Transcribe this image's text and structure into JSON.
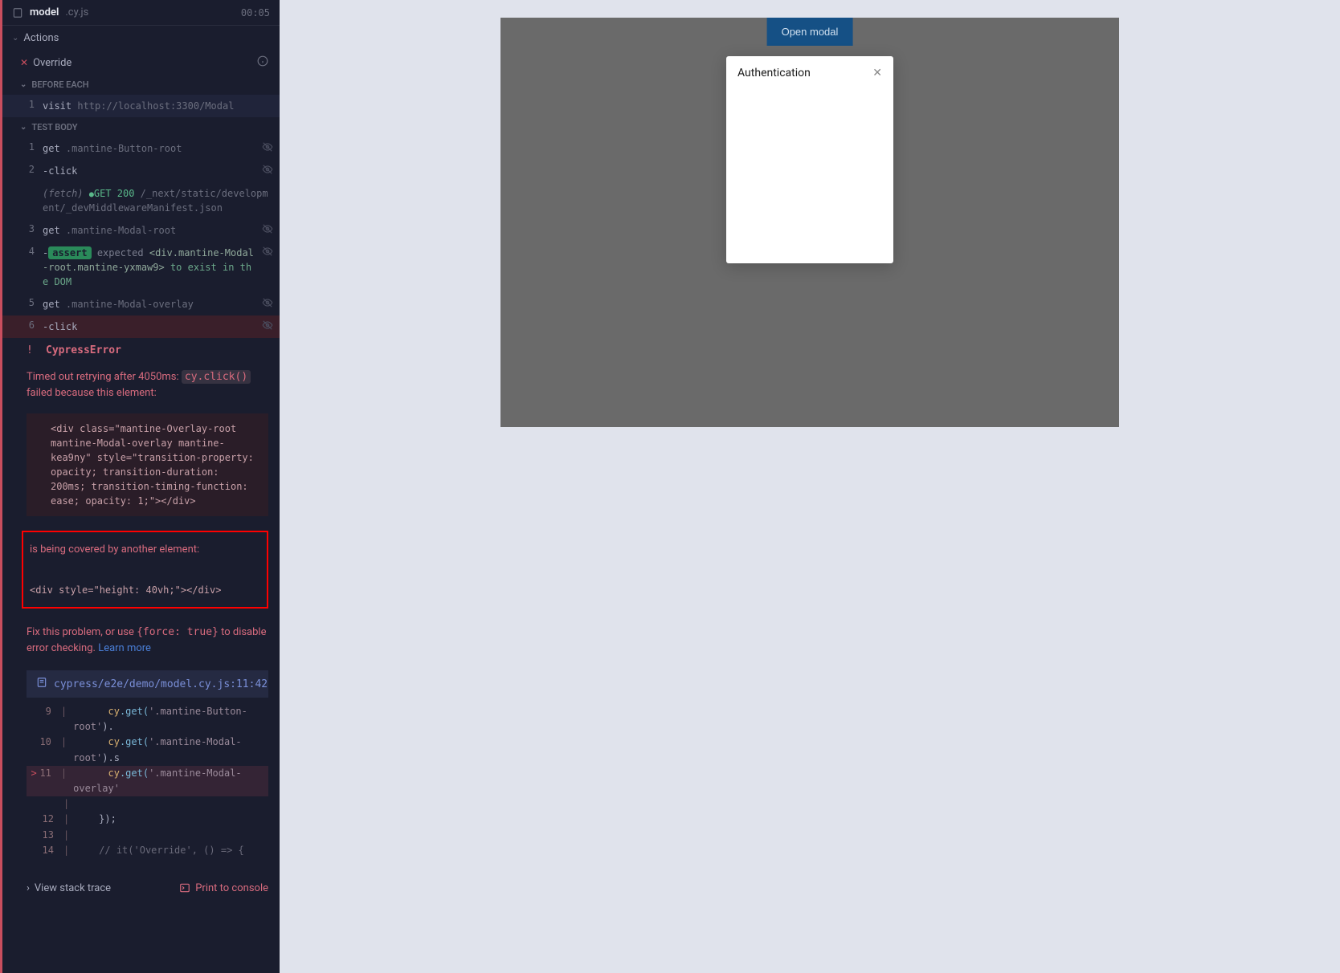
{
  "header": {
    "file_name": "model",
    "file_ext": ".cy.js",
    "timer": "00:05"
  },
  "actions_label": "Actions",
  "override_label": "Override",
  "sections": {
    "before_each": "BEFORE EACH",
    "test_body": "TEST BODY"
  },
  "before_each_cmd": {
    "num": "1",
    "keyword": "visit",
    "arg": "http://localhost:3300/Modal"
  },
  "commands": [
    {
      "num": "1",
      "keyword": "get",
      "arg": ".mantine-Button-root"
    },
    {
      "num": "2",
      "keyword": "-click",
      "arg": ""
    },
    {
      "num": "",
      "fetch": true,
      "fetch_label": "(fetch)",
      "status": "GET 200",
      "path": "/_next/static/development/_devMiddlewareManifest.json"
    },
    {
      "num": "3",
      "keyword": "get",
      "arg": ".mantine-Modal-root"
    },
    {
      "num": "4",
      "assert": true,
      "badge": "assert",
      "expected": "expected",
      "target": "<div.mantine-Modal-root.mantine-yxmaw9>",
      "to": "to exist in the DOM"
    },
    {
      "num": "5",
      "keyword": "get",
      "arg": ".mantine-Modal-overlay"
    },
    {
      "num": "6",
      "keyword": "-click",
      "arg": "",
      "error": true
    }
  ],
  "error": {
    "mark": "!",
    "title": "CypressError",
    "message_prefix": "Timed out retrying after 4050ms:",
    "message_code": "cy.click()",
    "message_suffix": "failed because this element:",
    "element_code": "<div class=\"mantine-Overlay-root mantine-Modal-overlay mantine-kea9ny\" style=\"transition-property: opacity; transition-duration: 200ms; transition-timing-function: ease; opacity: 1;\"></div>",
    "covered_text": "is being covered by another element:",
    "covered_code": "<div style=\"height: 40vh;\"></div>",
    "fix_prefix": "Fix this problem, or use",
    "fix_code": "{force: true}",
    "fix_suffix": "to disable error checking.",
    "learn_more": "Learn more",
    "file_location": "cypress/e2e/demo/model.cy.js:11:42",
    "code_lines": [
      {
        "marker": "",
        "num": "9",
        "code_cy": "cy",
        "code_get": ".get(",
        "code_str": "'.mantine-Button-root'",
        "code_end": ")."
      },
      {
        "marker": "",
        "num": "10",
        "code_cy": "cy",
        "code_get": ".get(",
        "code_str": "'.mantine-Modal-root'",
        "code_end": ").s"
      },
      {
        "marker": ">",
        "num": "11",
        "code_cy": "cy",
        "code_get": ".get(",
        "code_str": "'.mantine-Modal-overlay'",
        "code_end": "",
        "highlighted": true
      },
      {
        "marker": "",
        "num": "",
        "code_plain": ""
      },
      {
        "marker": "",
        "num": "12",
        "code_plain": "});"
      },
      {
        "marker": "",
        "num": "13",
        "code_plain": ""
      },
      {
        "marker": "",
        "num": "14",
        "code_comment": "// it('Override', () => {"
      }
    ],
    "view_stack": "View stack trace",
    "print_console": "Print to console"
  },
  "preview": {
    "open_modal": "Open modal",
    "modal_title": "Authentication"
  }
}
